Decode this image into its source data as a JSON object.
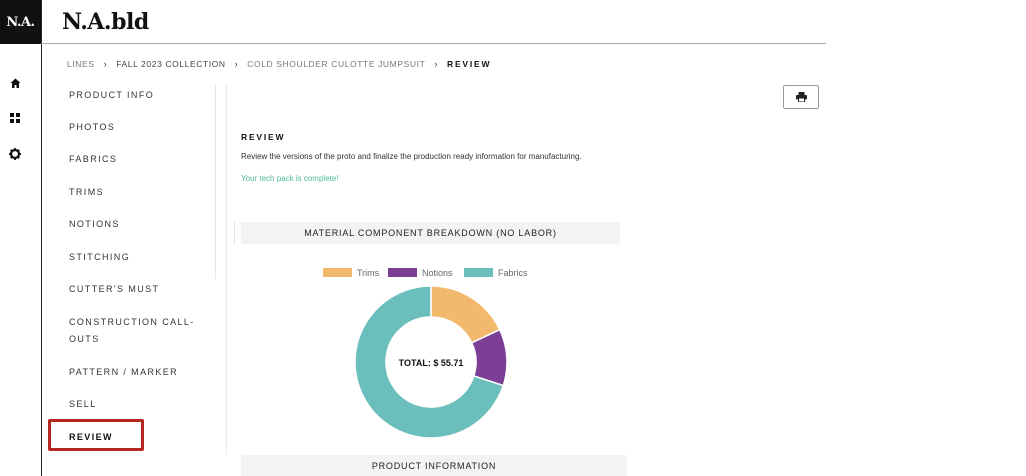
{
  "app": {
    "logo_text": "N.A.",
    "brand_text": "N.A.bld"
  },
  "rail": {
    "icons": [
      {
        "name": "home-icon"
      },
      {
        "name": "grid-icon"
      },
      {
        "name": "gear-icon"
      }
    ]
  },
  "breadcrumb": {
    "items": [
      "LINES",
      "FALL 2023 COLLECTION",
      "COLD SHOULDER CULOTTE JUMPSUIT"
    ],
    "current": "REVIEW"
  },
  "sidenav": {
    "items": [
      {
        "label": "PRODUCT INFO"
      },
      {
        "label": "PHOTOS"
      },
      {
        "label": "FABRICS"
      },
      {
        "label": "TRIMS"
      },
      {
        "label": "NOTIONS"
      },
      {
        "label": "STITCHING"
      },
      {
        "label": "CUTTER'S MUST"
      },
      {
        "label": "CONSTRUCTION CALL-OUTS"
      },
      {
        "label": "PATTERN / MARKER"
      },
      {
        "label": "SELL"
      },
      {
        "label": "REVIEW",
        "active": true
      }
    ]
  },
  "toolbar": {
    "print_icon": "print-icon"
  },
  "review": {
    "title": "REVIEW",
    "description": "Review the versions of the proto and finalize the production ready information for manufacturing.",
    "status": "Your tech pack is complete!"
  },
  "breakdown": {
    "header": "MATERIAL COMPONENT BREAKDOWN (NO LABOR)",
    "center_label": "TOTAL: $ 55.71"
  },
  "chart_data": {
    "type": "pie",
    "title": "MATERIAL COMPONENT BREAKDOWN (NO LABOR)",
    "categories": [
      "Trims",
      "Notions",
      "Fabrics"
    ],
    "values": [
      10.03,
      6.69,
      38.99
    ],
    "colors": [
      "#f2b86b",
      "#7b3f95",
      "#6abfbd"
    ],
    "total_label": "TOTAL: $ 55.71",
    "legend": "top",
    "donut": true
  },
  "product": {
    "header": "PRODUCT INFORMATION"
  }
}
